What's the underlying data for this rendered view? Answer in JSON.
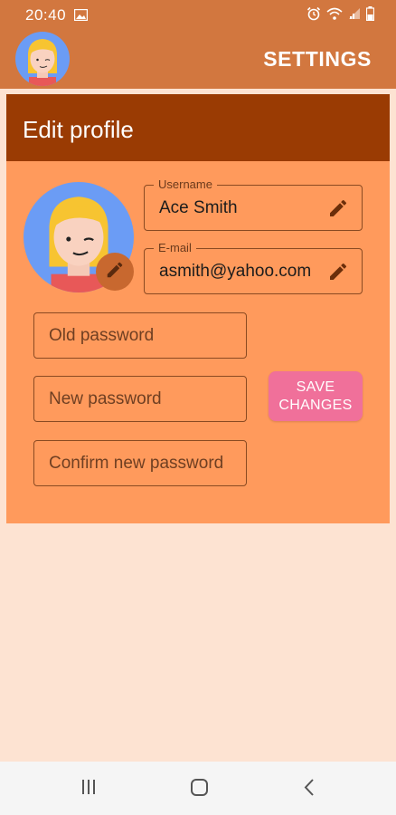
{
  "status_bar": {
    "time": "20:40"
  },
  "app_bar": {
    "title": "SETTINGS"
  },
  "card": {
    "title": "Edit profile"
  },
  "profile": {
    "username_label": "Username",
    "username_value": "Ace Smith",
    "email_label": "E-mail",
    "email_value": "asmith@yahoo.com"
  },
  "password": {
    "old_placeholder": "Old password",
    "new_placeholder": "New password",
    "confirm_placeholder": "Confirm new password"
  },
  "save_button": {
    "label_line1": "SAVE",
    "label_line2": "CHANGES"
  },
  "colors": {
    "app_bar": "#D2773F",
    "card_header": "#9A3B03",
    "card_body": "#FF9A5C",
    "page_bg": "#FDE3D2",
    "save_button": "#F0709A"
  },
  "icons": [
    "photo-icon",
    "alarm-icon",
    "wifi-icon",
    "signal-icon",
    "battery-icon",
    "pencil-icon",
    "recents-icon",
    "home-icon",
    "back-icon"
  ]
}
